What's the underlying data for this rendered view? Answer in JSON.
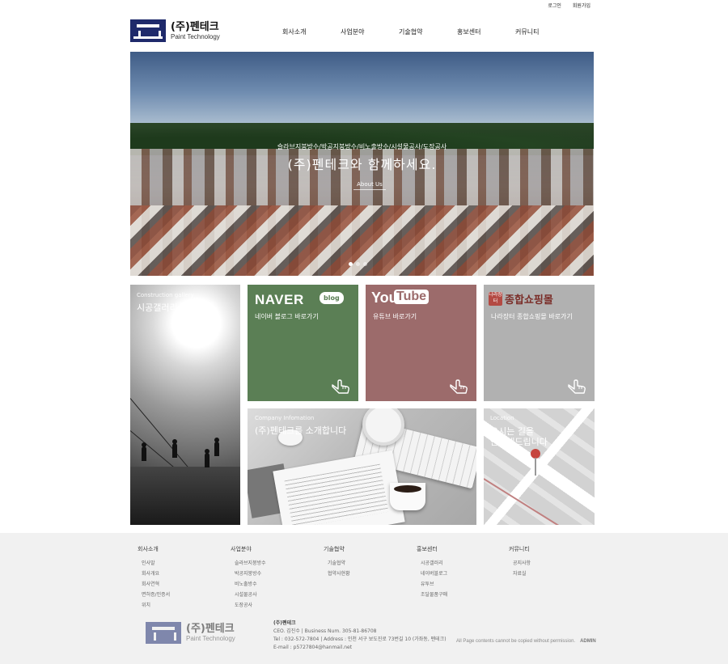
{
  "util": {
    "login": "로그인",
    "join": "회원가입"
  },
  "logo": {
    "kr": "(주)펜테크",
    "en": "Paint Technology"
  },
  "nav": [
    "회사소개",
    "사업분야",
    "기술협약",
    "홍보센터",
    "커뮤니티"
  ],
  "hero": {
    "sub": "슬라브지붕방수/박공지붕방수/비노출방수/시설물공사/도장공사",
    "title": "(주)펜테크와 함께하세요.",
    "button": "About Us"
  },
  "tiles": {
    "gallery": {
      "en": "Construction gallery",
      "kr": "시공갤러리"
    },
    "naver": {
      "brand": "NAVER",
      "badge": "blog",
      "desc": "네이버 블로그 바로가기"
    },
    "youtube": {
      "brand_you": "You",
      "brand_tube": "Tube",
      "desc": "유튜브 바로가기"
    },
    "shop": {
      "seal": "나라장터",
      "name": "종합쇼핑몰",
      "desc": "나라장터 종합쇼핑몰 바로가기"
    },
    "company": {
      "en": "Company Infomation",
      "kr": "(주)펜테크를 소개합니다"
    },
    "location": {
      "en": "Location",
      "kr1": "오시는 길을",
      "kr2": "안내해드립니다"
    }
  },
  "footer": {
    "cols": [
      {
        "title": "회사소개",
        "items": [
          "인사말",
          "회사개요",
          "회사연혁",
          "면허증/인증서",
          "위치"
        ]
      },
      {
        "title": "사업분야",
        "items": [
          "슬라브지붕방수",
          "박공지붕방수",
          "비노출방수",
          "시설물공사",
          "도장공사"
        ]
      },
      {
        "title": "기술협약",
        "items": [
          "기술협약",
          "협약사현황"
        ]
      },
      {
        "title": "홍보센터",
        "items": [
          "시공갤러리",
          "네이버블로그",
          "유투브",
          "조달물품구매"
        ]
      },
      {
        "title": "커뮤니티",
        "items": [
          "공지사항",
          "자료실"
        ]
      }
    ],
    "logo_kr": "(주)펜테크",
    "logo_en": "Paint Technology",
    "company": "(주)펜테크",
    "ceo": "CEO. 김진수 | Business Num. 305-81-86708",
    "tel": "Tel : 032-572-7804 | Address : 인천 서구 보도진로 73번길 10 (가좌동, 펜테크)",
    "email": "E-mail : p5727804@hanmail.net",
    "copyright": "All Page contents cannot be copied without permission.",
    "admin": "ADMIN"
  }
}
